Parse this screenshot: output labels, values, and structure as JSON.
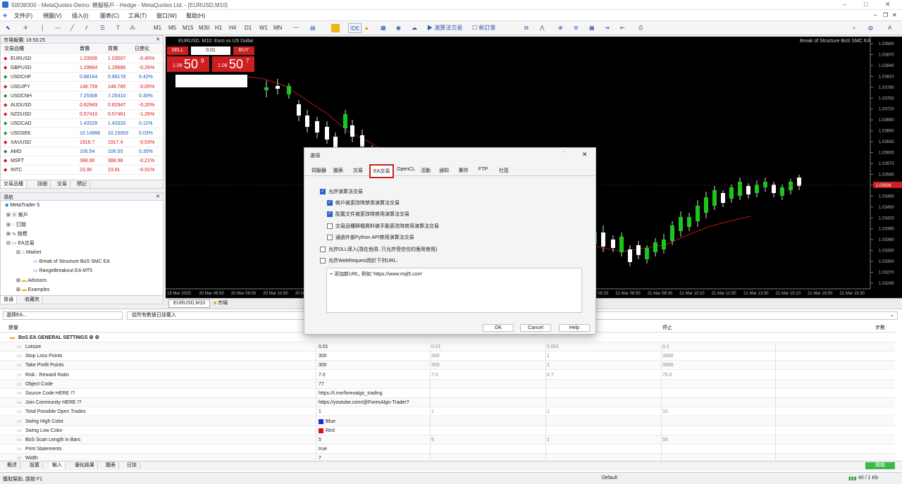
{
  "titlebar": {
    "text": "50038300 - MetaQuotes-Demo: 模擬帳戶 - Hedge - MetaQuotes Ltd. - [EURUSD,M10]",
    "min": "–",
    "max": "□",
    "close": "✕"
  },
  "menu": [
    "文件(F)",
    "視圖(V)",
    "插入(I)",
    "圖表(C)",
    "工具(T)",
    "窗口(W)",
    "幫助(H)"
  ],
  "toolbar": {
    "timeframes": [
      "M1",
      "M5",
      "M15",
      "M30",
      "H1",
      "H4",
      "D1",
      "W1",
      "MN"
    ],
    "ide": "IDE",
    "algo": "演算法交易",
    "new_order": "新訂單"
  },
  "market_watch": {
    "title": "市場報價: 18:50:25",
    "col_symbol": "交易品種",
    "col_bid": "賣價",
    "col_ask": "買價",
    "col_change": "日變化",
    "rows": [
      {
        "symbol": "EURUSD",
        "bid": "1.03506",
        "ask": "1.03507",
        "change": "-0.45%",
        "neg": true
      },
      {
        "symbol": "GBPUSD",
        "bid": "1.29664",
        "ask": "1.29666",
        "change": "-0.26%",
        "neg": true
      },
      {
        "symbol": "USDCHF",
        "bid": "0.88164",
        "ask": "0.88178",
        "change": "0.42%",
        "neg": false
      },
      {
        "symbol": "USDJPY",
        "bid": "148.759",
        "ask": "148.765",
        "change": "-0.05%",
        "neg": true
      },
      {
        "symbol": "USDCNH",
        "bid": "7.25308",
        "ask": "7.25410",
        "change": "0.30%",
        "neg": false
      },
      {
        "symbol": "AUDUSD",
        "bid": "0.62943",
        "ask": "0.62947",
        "change": "-0.20%",
        "neg": true
      },
      {
        "symbol": "NZDUSD",
        "bid": "0.57410",
        "ask": "0.57461",
        "change": "-1.26%",
        "neg": true
      },
      {
        "symbol": "USDCAD",
        "bid": "1.43328",
        "ask": "1.43333",
        "change": "0.11%",
        "neg": false
      },
      {
        "symbol": "USDSEK",
        "bid": "10.14988",
        "ask": "10.15003",
        "change": "0.03%",
        "neg": false
      },
      {
        "symbol": "XAUUSD",
        "bid": "1916.7",
        "ask": "1917.4",
        "change": "-0.53%",
        "neg": true
      },
      {
        "symbol": "AMD",
        "bid": "106.54",
        "ask": "106.55",
        "change": "0.30%",
        "neg": false
      },
      {
        "symbol": "MSFT",
        "bid": "388.90",
        "ask": "388.98",
        "change": "-0.21%",
        "neg": true
      },
      {
        "symbol": "INTC",
        "bid": "23.90",
        "ask": "23.91",
        "change": "-0.91%",
        "neg": true
      }
    ],
    "tabs": [
      "交易品種",
      "詳細",
      "交易",
      "標記"
    ]
  },
  "navigator": {
    "title": "導航",
    "items": [
      "MetaTrader 5",
      "帳戶",
      "訂閱",
      "指標",
      "EA交易",
      "Market",
      "Break of Structure BoS SMC EA",
      "RangeBreakout EA MT5",
      "Advisors",
      "Examples"
    ],
    "tabs": [
      "普通",
      "收藏夾"
    ]
  },
  "chart": {
    "symbol_info": "EURUSD, M10:  Euro vs US Dollar",
    "ea_label": "Break of Structure BoS SMC EA",
    "sell": "SELL",
    "buy": "BUY",
    "lot": "0.01",
    "sell_big": "50",
    "sell_small": "1.08",
    "sell_sup": "9",
    "buy_big": "50",
    "buy_small": "1.08",
    "buy_sup": "7",
    "prices": [
      "1.03900",
      "1.03870",
      "1.03840",
      "1.03810",
      "1.03780",
      "1.03750",
      "1.03720",
      "1.03690",
      "1.03660",
      "1.03630",
      "1.03600",
      "1.03570",
      "1.03540",
      "1.03506",
      "1.03480",
      "1.03450",
      "1.03420",
      "1.03390",
      "1.03360",
      "1.03330",
      "1.03300",
      "1.03270",
      "1.03240"
    ],
    "current": "1.03506",
    "times": [
      "19 Mar 2025",
      "20 Mar 06:50",
      "20 Mar 09:00",
      "20 Mar 10:50",
      "20 Mar 12:30",
      "20 Mar 14:10",
      "20 Mar 15:50",
      "20 Mar 17:30",
      "20 Mar 19:10",
      "20 Mar 20:50",
      "21 Mar 00:10",
      "21 Mar 01:50",
      "21 Mar 03:30",
      "21 Mar 05:10",
      "21 Mar 06:50",
      "21 Mar 08:30",
      "21 Mar 10:10",
      "21 Mar 11:50",
      "21 Mar 13:30",
      "21 Mar 15:10",
      "21 Mar 16:50",
      "21 Mar 18:30"
    ],
    "tabs": [
      "EURUSD,M10",
      "市場"
    ]
  },
  "dialog": {
    "title": "選項",
    "tabs": [
      "伺服器",
      "圖表",
      "交易",
      "EA交易",
      "OpenCL",
      "活動",
      "通知",
      "郵件",
      "FTP",
      "社區"
    ],
    "active_tab": "EA交易",
    "options": [
      {
        "label": "允許演算法交易",
        "checked": true
      },
      {
        "label": "帳戶被更改時禁用演算法交易",
        "checked": true
      },
      {
        "label": "配置文件被更改時禁用演算法交易",
        "checked": true
      },
      {
        "label": "交易品種歸檔資料被手動更改時禁用演算法交易",
        "checked": false
      },
      {
        "label": "通過外部Python API禁用演算法交易",
        "checked": false
      },
      {
        "label": "允許DLL導入(潛在危險, 只允許受信任的應用使用)",
        "checked": false
      },
      {
        "label": "允許WebRequest用於下列URL:",
        "checked": false
      }
    ],
    "url_item": "+ 添加新URL, 例如 'https://www.mql5.com'",
    "ok": "OK",
    "cancel": "Cancel",
    "help": "Help"
  },
  "bottom": {
    "dropdown": "選擇EA...",
    "dropdown2": "從所有數據日誌載入",
    "col_var": "變量",
    "col_val": "數值",
    "col_start": "開始",
    "col_step": "步長",
    "col_stop": "停止",
    "col_steps": "步數",
    "group": "BoS EA GENERAL SETTINGS ⚙ ⚙",
    "params": [
      {
        "name": "Lotsize",
        "val": "0.01",
        "start": "0.01",
        "step": "0.001",
        "stop": "0.1"
      },
      {
        "name": "Stop Loss Points",
        "val": "300",
        "start": "300",
        "step": "1",
        "stop": "3000"
      },
      {
        "name": "Take Profit Points",
        "val": "300",
        "start": "300",
        "step": "1",
        "stop": "3000"
      },
      {
        "name": "Risk : Reward Ratio",
        "val": "7.0",
        "start": "7.0",
        "step": "0.7",
        "stop": "70.0"
      },
      {
        "name": "Object Code",
        "val": "77",
        "start": "",
        "step": "",
        "stop": ""
      },
      {
        "name": "Source Code HERE !?",
        "val": "https://t.me/forexalgo_trading",
        "start": "",
        "step": "",
        "stop": ""
      },
      {
        "name": "Join Community HERE !?",
        "val": "https://youtube.com/@ForexAlgo-Trader?",
        "start": "",
        "step": "",
        "stop": ""
      },
      {
        "name": "Total Possible Open Trades",
        "val": "1",
        "start": "1",
        "step": "1",
        "stop": "10"
      },
      {
        "name": "Swing High Color",
        "val": "Blue",
        "start": "",
        "step": "",
        "stop": ""
      },
      {
        "name": "Swing Low Color",
        "val": "Red",
        "start": "",
        "step": "",
        "stop": ""
      },
      {
        "name": "BoS Scan Length in Bars",
        "val": "5",
        "start": "5",
        "step": "1",
        "stop": "50"
      },
      {
        "name": "Print Statements",
        "val": "true",
        "start": "",
        "step": "",
        "stop": ""
      },
      {
        "name": "Width",
        "val": "7",
        "start": "",
        "step": "",
        "stop": ""
      }
    ],
    "tabs": [
      "概述",
      "設置",
      "輸入",
      "優化結果",
      "圖表",
      "日誌"
    ],
    "start_button": "開始"
  },
  "status": {
    "help": "獲取幫助, 請按 F1",
    "profile": "Default",
    "net": "40 / 1 Kb"
  },
  "colors": {
    "bull": "#19c819",
    "bear": "#ffffff",
    "ma": "#b01818",
    "accent": "#2563c9",
    "highlight": "#cc1f1f"
  }
}
